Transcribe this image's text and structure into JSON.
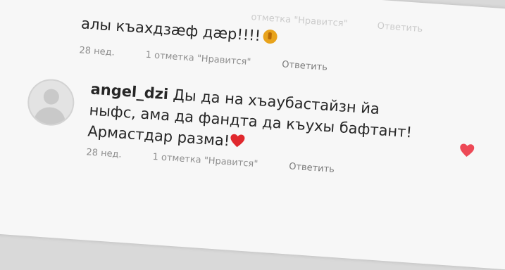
{
  "ghost_meta": {
    "marks": "отметка \"Нравится\"",
    "reply": "Ответить"
  },
  "comments": [
    {
      "text": "алы къахдзæф дæр!!!!",
      "emoji": "thumbs-up-emoji",
      "meta": {
        "time": "28 нед.",
        "likes": "1 отметка \"Нравится\"",
        "reply": "Ответить"
      }
    },
    {
      "username": "angel_dzi",
      "text_line1": "Ды да на хъаубастайзн йа",
      "text_line2": "ныфс, ама да фандта да къухы бафтант!",
      "text_line3": "Армастдар разма!",
      "emoji": "red-heart-emoji",
      "liked": true,
      "like_color": "#ed4956",
      "meta": {
        "time": "28 нед.",
        "likes": "1 отметка \"Нравится\"",
        "reply": "Ответить"
      }
    }
  ]
}
